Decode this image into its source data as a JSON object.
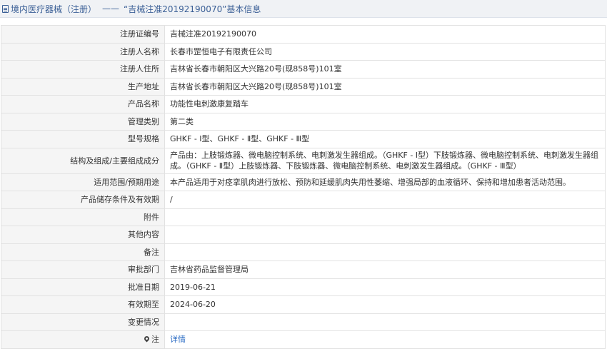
{
  "header": {
    "title": "境内医疗器械（注册）",
    "separator": "——",
    "subtitle": "“吉械注准20192190070”基本信息",
    "accent_color": "#3a5f96"
  },
  "rows": [
    {
      "label": "注册证编号",
      "value": "吉械注准20192190070"
    },
    {
      "label": "注册人名称",
      "value": "长春市罡恒电子有限责任公司"
    },
    {
      "label": "注册人住所",
      "value": "吉林省长春市朝阳区大兴路20号(现858号)101室"
    },
    {
      "label": "生产地址",
      "value": "吉林省长春市朝阳区大兴路20号(现858号)101室"
    },
    {
      "label": "产品名称",
      "value": "功能性电刺激康复踏车"
    },
    {
      "label": "管理类别",
      "value": "第二类"
    },
    {
      "label": "型号规格",
      "value": "GHKF - Ⅰ型、GHKF - Ⅱ型、GHKF - Ⅲ型"
    },
    {
      "label": "结构及组成/主要组成成分",
      "value": "产品由：上肢锻炼器、微电脑控制系统、电刺激发生器组成。（GHKF - Ⅰ型）下肢锻炼器、微电脑控制系统、电刺激发生器组成。（GHKF - Ⅱ型）上肢锻炼器、下肢锻炼器、微电脑控制系统、电刺激发生器组成。（GHKF - Ⅲ型）"
    },
    {
      "label": "适用范围/预期用途",
      "value": "本产品适用于对痉挛肌肉进行放松、预防和延缓肌肉失用性萎缩、增强局部的血液循环、保持和增加患者活动范围。"
    },
    {
      "label": "产品储存条件及有效期",
      "value": "/"
    },
    {
      "label": "附件",
      "value": ""
    },
    {
      "label": "其他内容",
      "value": ""
    },
    {
      "label": "备注",
      "value": ""
    },
    {
      "label": "审批部门",
      "value": "吉林省药品监督管理局"
    },
    {
      "label": "批准日期",
      "value": "2019-06-21"
    },
    {
      "label": "有效期至",
      "value": "2024-06-20"
    },
    {
      "label": "变更情况",
      "value": ""
    },
    {
      "label": "注",
      "value": "详情",
      "icon": "map-pin-icon"
    }
  ]
}
